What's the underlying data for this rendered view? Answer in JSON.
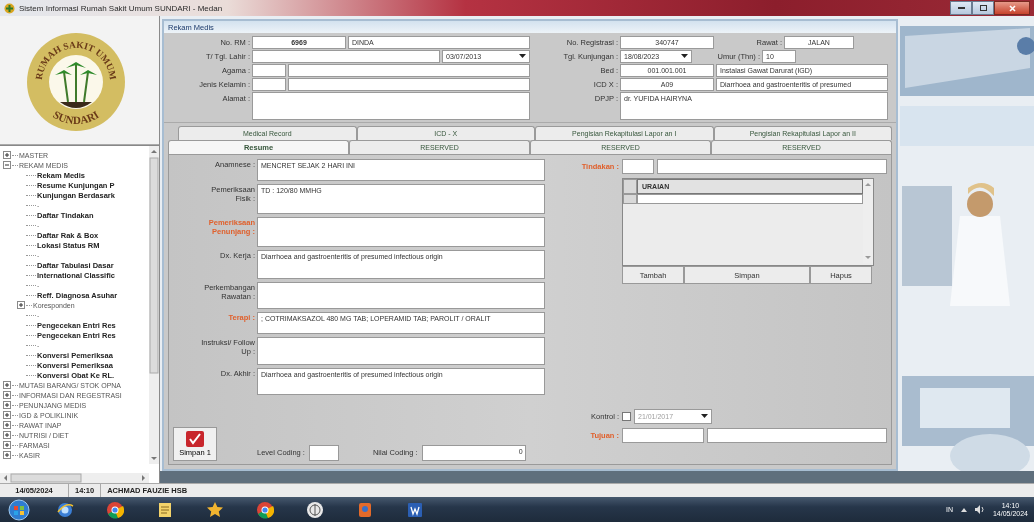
{
  "window": {
    "title": "Sistem Informasi Rumah Sakit Umum SUNDARI - Medan"
  },
  "sidebar": {
    "logo": {
      "top_text": "RUMAH SAKIT UMUM",
      "bottom_text": "SUNDARI"
    },
    "tree": [
      {
        "label": "MASTER",
        "expanded": false
      },
      {
        "label": "REKAM MEDIS",
        "expanded": true,
        "children": [
          {
            "kind": "form",
            "label": "Rekam Medis"
          },
          {
            "kind": "form",
            "label": "Resume Kunjungan P"
          },
          {
            "kind": "form",
            "label": "Kunjungan Berdasark"
          },
          {
            "kind": "separator",
            "label": "-"
          },
          {
            "kind": "form",
            "label": "Daftar Tindakan"
          },
          {
            "kind": "separator",
            "label": "-"
          },
          {
            "kind": "form",
            "label": "Daftar Rak & Box"
          },
          {
            "kind": "form",
            "label": "Lokasi Status RM"
          },
          {
            "kind": "separator",
            "label": "-"
          },
          {
            "kind": "form",
            "label": "Daftar Tabulasi Dasar"
          },
          {
            "kind": "form",
            "label": "International Classific"
          },
          {
            "kind": "separator",
            "label": "-"
          },
          {
            "kind": "form",
            "label": "Reff. Diagnosa Asuhar"
          },
          {
            "kind": "group",
            "label": "Koresponden",
            "expanded": false
          },
          {
            "kind": "separator",
            "label": "-"
          },
          {
            "kind": "form",
            "label": "Pengecekan Entri Res"
          },
          {
            "kind": "form",
            "label": "Pengecekan Entri Res"
          },
          {
            "kind": "separator",
            "label": "-"
          },
          {
            "kind": "form",
            "label": "Konversi Pemeriksaa"
          },
          {
            "kind": "form",
            "label": "Konversi Pemeriksaa"
          },
          {
            "kind": "form",
            "label": "Konversi Obat Ke RL."
          }
        ]
      },
      {
        "label": "MUTASI BARANG/ STOK OPNA",
        "expanded": false
      },
      {
        "label": "INFORMASI DAN REGESTRASI",
        "expanded": false
      },
      {
        "label": "PENUNJANG MEDIS",
        "expanded": false
      },
      {
        "label": "IGD & POLIKLINIK",
        "expanded": false
      },
      {
        "label": "RAWAT INAP",
        "expanded": false
      },
      {
        "label": "NUTRISI / DIET",
        "expanded": false
      },
      {
        "label": "FARMASI",
        "expanded": false
      },
      {
        "label": "KASIR",
        "expanded": false
      }
    ]
  },
  "form": {
    "title": "Rekam Medis",
    "patient": [
      {
        "label": "No. RM :",
        "items": [
          {
            "kind": "id",
            "value": "6969"
          },
          {
            "kind": "text",
            "value": "DINDA"
          }
        ]
      },
      {
        "label": "T/ Tgl. Lahir :",
        "items": [
          {
            "kind": "text"
          },
          {
            "kind": "date",
            "value": "03/07/2013"
          }
        ]
      },
      {
        "label": "Agama :",
        "items": [
          {
            "kind": "short"
          },
          {
            "kind": "text"
          }
        ]
      },
      {
        "label": "Jenis Kelamin :",
        "items": [
          {
            "kind": "short"
          },
          {
            "kind": "text"
          }
        ]
      },
      {
        "label": "Alamat :",
        "items": [
          {
            "kind": "area"
          }
        ]
      }
    ],
    "visit": [
      {
        "label": "No. Registrasi :",
        "items": [
          {
            "kind": "code",
            "value": "340747"
          },
          {
            "kind": "label",
            "value": "Rawat :"
          },
          {
            "kind": "tag",
            "value": "JALAN"
          }
        ]
      },
      {
        "label": "Tgl. Kunjungan :",
        "items": [
          {
            "kind": "date",
            "value": "18/08/2023"
          },
          {
            "kind": "label",
            "value": "Umur (Thn) :"
          },
          {
            "kind": "short",
            "value": "10"
          }
        ]
      },
      {
        "label": "Bed :",
        "items": [
          {
            "kind": "code",
            "value": "001.001.001"
          },
          {
            "kind": "text",
            "value": "Instalasi Gawat Darurat (IGD)"
          }
        ]
      },
      {
        "label": "ICD X :",
        "items": [
          {
            "kind": "code",
            "value": "A09"
          },
          {
            "kind": "text",
            "value": "Diarrhoea and gastroenteritis of presumed"
          }
        ]
      },
      {
        "label": "DPJP :",
        "items": [
          {
            "kind": "area",
            "value": "dr. YUFIDA HAIRYNA"
          }
        ]
      }
    ]
  },
  "tab_rows": [
    [
      {
        "label": "Medical Record",
        "selected": false
      },
      {
        "label": "ICD - X",
        "selected": false
      },
      {
        "label": "Pengisian Rekapitulasi Lapor an I",
        "selected": false
      },
      {
        "label": "Pengisian Rekapitulasi Lapor an II",
        "selected": false
      }
    ],
    [
      {
        "label": "Resume",
        "selected": true
      },
      {
        "label": "RESERVED",
        "selected": false
      },
      {
        "label": "RESERVED",
        "selected": false
      },
      {
        "label": "RESERVED",
        "selected": false
      }
    ]
  ],
  "resume": {
    "fields": [
      {
        "label": "Anamnese :",
        "required": false,
        "value": "MENCRET SEJAK 2 HARI INI"
      },
      {
        "label": "Pemeriksaan Fisik :",
        "required": false,
        "value": "TD : 120/80 MMHG"
      },
      {
        "label": "Pemeriksaan Penunjang :",
        "required": true
      },
      {
        "label": "Dx. Kerja :",
        "required": false,
        "value": "Diarrhoea and gastroenteritis of presumed infectious origin"
      },
      {
        "label": "Perkembangan Rawatan :",
        "required": false
      },
      {
        "label": "Terapi :",
        "required": true,
        "value": "; COTRIMAKSAZOL 480 MG TAB; LOPERAMID TAB; PAROLIT / ORALIT"
      },
      {
        "label": "Instruksi/ Follow Up :",
        "required": false
      },
      {
        "label": "Dx. Akhir :",
        "required": false,
        "value": "Diarrhoea and gastroenteritis of presumed infectious origin"
      }
    ],
    "save_button": "Simpan 1",
    "level_coding": {
      "label": "Level Coding :"
    },
    "nilai_coding": {
      "label": "Nilai Coding :",
      "value": "0"
    }
  },
  "tindakan": {
    "label": "Tindakan :",
    "required": true,
    "grid": {
      "columns": [
        "URAIAN"
      ]
    },
    "buttons": [
      "Tambah",
      "Simpan",
      "Hapus"
    ],
    "kontrol": {
      "label": "Kontrol :",
      "checked": false,
      "disabled": true,
      "date": "21/01/2017"
    },
    "tujuan": {
      "label": "Tujuan :",
      "required": true
    }
  },
  "status_bar": [
    "14/05/2024",
    "14:10",
    "ACHMAD FAUZIE HSB"
  ],
  "taskbar": {
    "apps": [
      {
        "kind": "ie"
      },
      {
        "kind": "chrome"
      },
      {
        "kind": "notes"
      },
      {
        "kind": "star"
      },
      {
        "kind": "chrome"
      },
      {
        "kind": "emblem"
      },
      {
        "kind": "paint"
      },
      {
        "kind": "word"
      }
    ],
    "language": "IN",
    "time": "14:10",
    "date": "14/05/2024"
  }
}
